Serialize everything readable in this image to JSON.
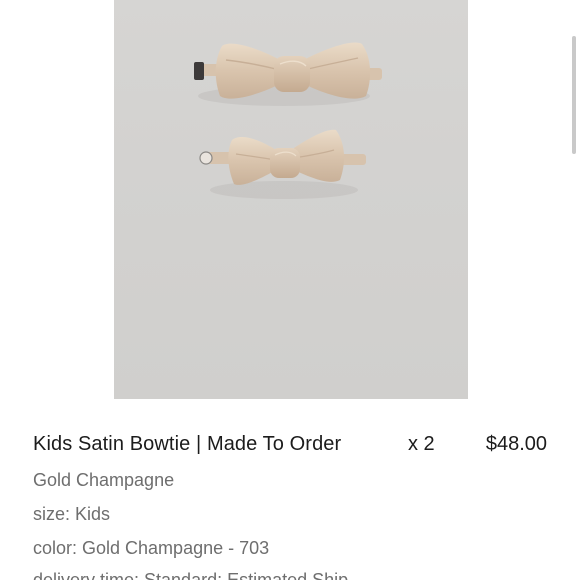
{
  "product": {
    "image_alt": "Two gold champagne satin bowties, adult and kids size",
    "title": "Kids Satin Bowtie | Made To Order",
    "quantity": "x 2",
    "price": "$48.00",
    "variant": "Gold Champagne",
    "size_line": "size: Kids",
    "color_line": "color: Gold Champagne - 703",
    "delivery_line": "delivery time: Standard: Estimated Ship"
  },
  "colors": {
    "image_background": "#d4d3d1",
    "bowtie_satin": "#dcc8b2",
    "text_primary": "#1c1c1c",
    "text_secondary": "#6e6e6e"
  }
}
